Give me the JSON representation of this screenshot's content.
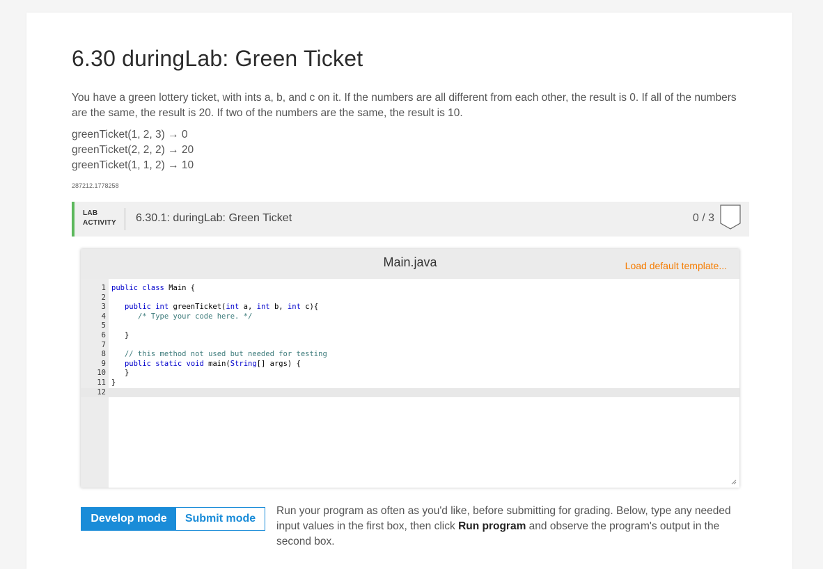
{
  "page": {
    "title": "6.30 duringLab: Green Ticket",
    "description": "You have a green lottery ticket, with ints a, b, and c on it. If the numbers are all different from each other, the result is 0. If all of the numbers are the same, the result is 20. If two of the numbers are the same, the result is 10.",
    "examples": [
      "greenTicket(1, 2, 3) → 0",
      "greenTicket(2, 2, 2) → 20",
      "greenTicket(1, 1, 2) → 10"
    ],
    "activity_id": "287212.1778258"
  },
  "lab": {
    "tag_line1": "LAB",
    "tag_line2": "ACTIVITY",
    "name": "6.30.1: duringLab: Green Ticket",
    "score": "0 / 3"
  },
  "editor": {
    "file_name": "Main.java",
    "load_template_label": "Load default template...",
    "line_numbers": [
      "1",
      "2",
      "3",
      "4",
      "5",
      "6",
      "7",
      "8",
      "9",
      "10",
      "11",
      "12"
    ],
    "lines": [
      "public class Main {",
      "",
      "   public int greenTicket(int a, int b, int c){",
      "      /* Type your code here. */",
      "",
      "   }",
      "",
      "   // this method not used but needed for testing",
      "   public static void main(String[] args) {",
      "   }",
      "}",
      ""
    ]
  },
  "modes": {
    "develop_label": "Develop mode",
    "submit_label": "Submit mode"
  },
  "instructions": {
    "part1": "Run your program as often as you'd like, before submitting for grading. Below, type any needed input values in the first box, then click ",
    "bold": "Run program",
    "part2": " and observe the program's output in the second box."
  },
  "colors": {
    "accent_blue": "#1a8cd8",
    "lab_green": "#5cb85c",
    "link_orange": "#f57c00"
  }
}
